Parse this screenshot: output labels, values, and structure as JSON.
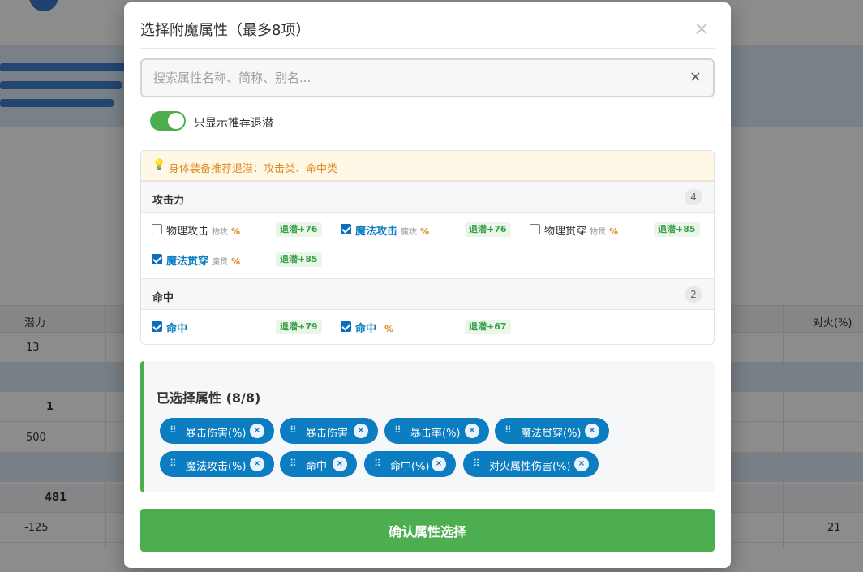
{
  "modal": {
    "title": "选择附魔属性（最多8项）",
    "close_icon": "×"
  },
  "search": {
    "placeholder": "搜索属性名称、简称、别名...",
    "value": "",
    "clear_icon": "×"
  },
  "filter": {
    "label": "只显示推荐退潜",
    "enabled": true
  },
  "tip": {
    "icon": "lightbulb-icon",
    "text": "身体装备推荐退潜：攻击类、命中类"
  },
  "groups": [
    {
      "name": "攻击力",
      "count": "4",
      "items": [
        {
          "name": "物理攻击",
          "abbr": "物攻",
          "pct": "%",
          "bonus": "退潜+76",
          "checked": false
        },
        {
          "name": "魔法攻击",
          "abbr": "魔攻",
          "pct": "%",
          "bonus": "退潜+76",
          "checked": true
        },
        {
          "name": "物理贯穿",
          "abbr": "物贯",
          "pct": "%",
          "bonus": "退潜+85",
          "checked": false
        },
        {
          "name": "魔法贯穿",
          "abbr": "魔贯",
          "pct": "%",
          "bonus": "退潜+85",
          "checked": true
        }
      ]
    },
    {
      "name": "命中",
      "count": "2",
      "items": [
        {
          "name": "命中",
          "abbr": "",
          "pct": "",
          "bonus": "退潜+79",
          "checked": true
        },
        {
          "name": "命中",
          "abbr": "",
          "pct": "%",
          "bonus": "退潜+67",
          "checked": true
        }
      ]
    }
  ],
  "selected": {
    "title": "已选择属性 (8/8)",
    "handle_icon": "⠿",
    "remove_icon": "×",
    "chips": [
      "暴击伤害(%)",
      "暴击伤害",
      "暴击率(%)",
      "魔法贯穿(%)",
      "魔法攻击(%)",
      "命中",
      "命中(%)",
      "对火属性伤害(%)"
    ]
  },
  "confirm_label": "确认属性选择",
  "background": {
    "headers": [
      "潜力",
      "对火(%)"
    ],
    "rows": [
      {
        "left": "13",
        "right": ""
      },
      {
        "left": "1",
        "right": ""
      },
      {
        "left": "500",
        "right": ""
      },
      {
        "left": "481",
        "right": ""
      },
      {
        "left": "-125",
        "right": "21"
      }
    ],
    "colors": {
      "accent": "#0b7dc0",
      "success": "#4cae4f",
      "warning": "#e08a1c"
    }
  }
}
